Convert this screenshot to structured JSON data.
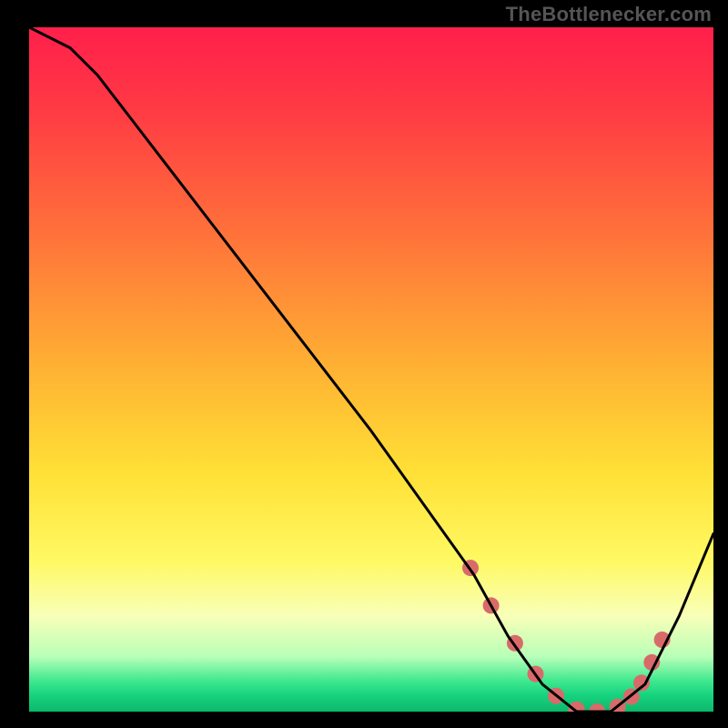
{
  "attribution": "TheBottlenecker.com",
  "chart_data": {
    "type": "line",
    "title": "",
    "xlabel": "",
    "ylabel": "",
    "xlim": [
      0,
      100
    ],
    "ylim": [
      0,
      100
    ],
    "series": [
      {
        "name": "curve",
        "x": [
          0,
          6,
          10,
          20,
          30,
          40,
          50,
          60,
          65,
          70,
          75,
          80,
          85,
          90,
          95,
          100
        ],
        "y": [
          100,
          97,
          93,
          80,
          67,
          54,
          41,
          27,
          20,
          11,
          4,
          0,
          0,
          4,
          14,
          26
        ]
      }
    ],
    "markers": {
      "name": "highlight-points",
      "x": [
        64.5,
        67.5,
        71,
        74,
        77,
        80,
        83,
        86,
        88,
        89.5,
        91,
        92.5
      ],
      "y_line": [
        21,
        15.5,
        10,
        5.5,
        2.3,
        0.3,
        0,
        0.7,
        2.2,
        4.2,
        7.2,
        10.5
      ]
    },
    "gradient_stops": [
      {
        "offset": 0.0,
        "color": "#ff1f4b"
      },
      {
        "offset": 0.12,
        "color": "#ff3a44"
      },
      {
        "offset": 0.3,
        "color": "#ff713a"
      },
      {
        "offset": 0.5,
        "color": "#ffb233"
      },
      {
        "offset": 0.65,
        "color": "#ffe036"
      },
      {
        "offset": 0.78,
        "color": "#fff963"
      },
      {
        "offset": 0.86,
        "color": "#f8ffb8"
      },
      {
        "offset": 0.92,
        "color": "#b8ffb8"
      },
      {
        "offset": 0.955,
        "color": "#3fe88f"
      },
      {
        "offset": 0.975,
        "color": "#18d47f"
      },
      {
        "offset": 1.0,
        "color": "#0cb86b"
      }
    ],
    "curve_color": "#000000",
    "curve_width": 3,
    "marker_color": "#d96a6a",
    "marker_radius": 9
  }
}
